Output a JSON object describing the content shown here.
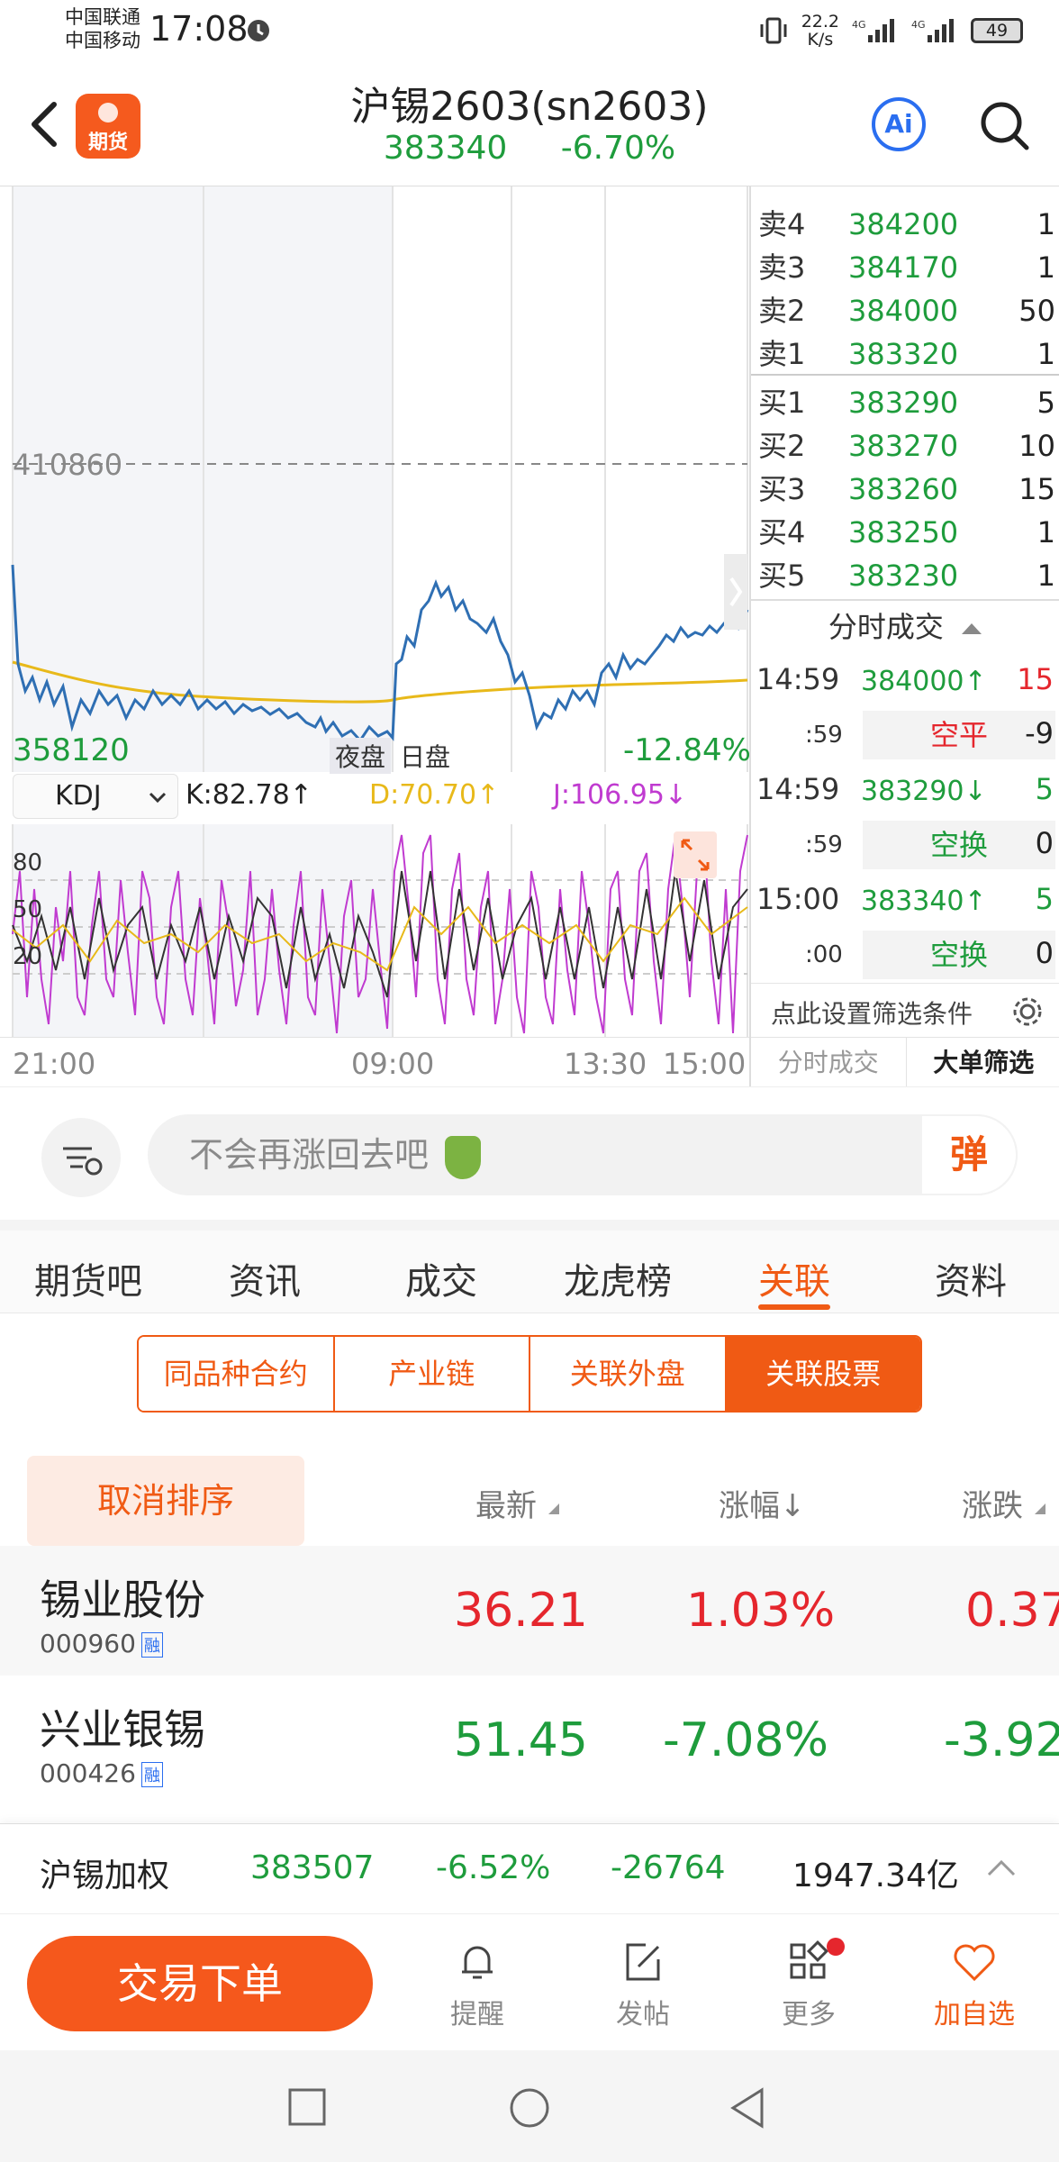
{
  "status_bar": {
    "carrier1": "中国联通",
    "carrier2": "中国移动",
    "time": "17:08",
    "speed_value": "22.2",
    "speed_unit": "K/s",
    "battery": "49"
  },
  "header": {
    "title": "沪锡2603(sn2603)",
    "price": "383340",
    "change": "-6.70%",
    "logo_label": "期货",
    "ai_label": "Ai"
  },
  "chart": {
    "ref_price": "410860",
    "low_price": "358120",
    "low_pct": "-12.84%",
    "session_night": "夜盘",
    "session_day": "日盘",
    "indicator": "KDJ",
    "k_label": "K:82.78↑",
    "d_label": "D:70.70↑",
    "j_label": "J:106.95↓",
    "levels": [
      "80",
      "50",
      "20"
    ],
    "time_axis": [
      "21:00",
      "09:00",
      "13:30",
      "15:00"
    ]
  },
  "orderbook": {
    "asks": [
      {
        "label": "卖4",
        "price": "384200",
        "vol": "1"
      },
      {
        "label": "卖3",
        "price": "384170",
        "vol": "1"
      },
      {
        "label": "卖2",
        "price": "384000",
        "vol": "50"
      },
      {
        "label": "卖1",
        "price": "383320",
        "vol": "1"
      }
    ],
    "bids": [
      {
        "label": "买1",
        "price": "383290",
        "vol": "5"
      },
      {
        "label": "买2",
        "price": "383270",
        "vol": "10"
      },
      {
        "label": "买3",
        "price": "383260",
        "vol": "15"
      },
      {
        "label": "买4",
        "price": "383250",
        "vol": "1"
      },
      {
        "label": "买5",
        "price": "383230",
        "vol": "1"
      }
    ],
    "trades_header": "分时成交",
    "trades": [
      {
        "time": "14:59",
        "sec": ":59",
        "price": "384000↑",
        "vol": "15",
        "tag": "空平",
        "tag_val": "-9",
        "dir": "up"
      },
      {
        "time": "14:59",
        "sec": ":59",
        "price": "383290↓",
        "vol": "5",
        "tag": "空换",
        "tag_val": "0",
        "dir": "down"
      },
      {
        "time": "15:00",
        "sec": ":00",
        "price": "383340↑",
        "vol": "5",
        "tag": "空换",
        "tag_val": "0",
        "dir": "up"
      }
    ],
    "filter_label": "点此设置筛选条件",
    "tab_left": "分时成交",
    "tab_right": "大单筛选"
  },
  "comment": {
    "placeholder": "不会再涨回去吧",
    "danmu": "弹"
  },
  "tabs": [
    "期货吧",
    "资讯",
    "成交",
    "龙虎榜",
    "关联",
    "资料"
  ],
  "segments": [
    "同品种合约",
    "产业链",
    "关联外盘",
    "关联股票"
  ],
  "table": {
    "cancel_sort": "取消排序",
    "col_latest": "最新",
    "col_pct": "涨幅↓",
    "col_change": "涨跌",
    "rows": [
      {
        "name": "锡业股份",
        "code": "000960",
        "badge": "融",
        "latest": "36.21",
        "pct": "1.03%",
        "change": "0.37",
        "dir": "up"
      },
      {
        "name": "兴业银锡",
        "code": "000426",
        "badge": "融",
        "latest": "51.45",
        "pct": "-7.08%",
        "change": "-3.92",
        "dir": "down"
      }
    ]
  },
  "summary": {
    "name": "沪锡加权",
    "price": "383507",
    "pct": "-6.52%",
    "change": "-26764",
    "amount": "1947.34亿"
  },
  "actions": {
    "trade": "交易下单",
    "remind": "提醒",
    "post": "发帖",
    "more": "更多",
    "watch": "加自选"
  },
  "colors": {
    "accent": "#f05a14",
    "up": "#e5262d",
    "down": "#1e9c3c"
  }
}
